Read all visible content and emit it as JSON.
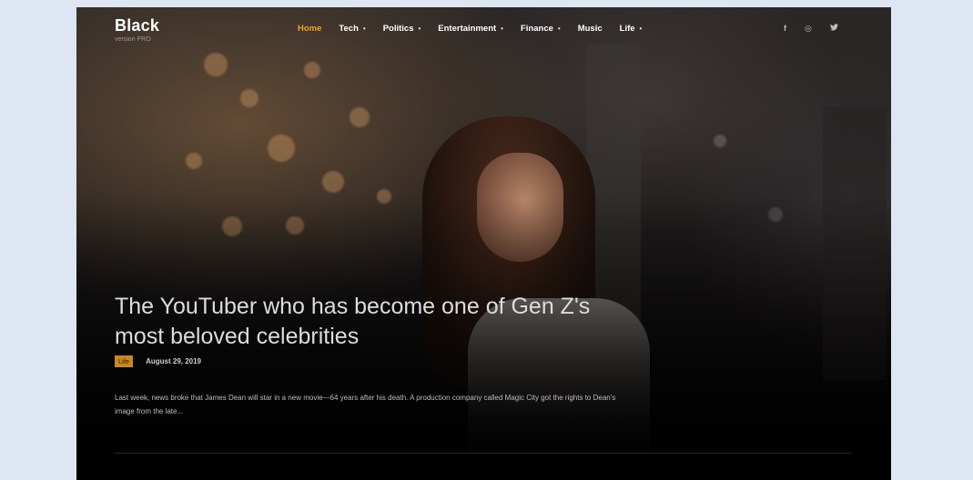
{
  "brand": {
    "name": "Black",
    "subtitle": "version PRO"
  },
  "nav": {
    "items": [
      {
        "label": "Home",
        "active": true,
        "dropdown": false
      },
      {
        "label": "Tech",
        "active": false,
        "dropdown": true
      },
      {
        "label": "Politics",
        "active": false,
        "dropdown": true
      },
      {
        "label": "Entertainment",
        "active": false,
        "dropdown": true
      },
      {
        "label": "Finance",
        "active": false,
        "dropdown": true
      },
      {
        "label": "Music",
        "active": false,
        "dropdown": false
      },
      {
        "label": "Life",
        "active": false,
        "dropdown": true
      }
    ],
    "dropdown_glyph": "•"
  },
  "social": {
    "facebook": "f",
    "instagram": "◎",
    "twitter": "🐦"
  },
  "hero": {
    "title": "The YouTuber who has become one of Gen Z's most beloved celebrities",
    "category": "Life",
    "date": "August 29, 2019",
    "excerpt": "Last week, news broke that James Dean will star in a new movie—64 years after his death. A production company called Magic City got the rights to Dean's image from the late..."
  },
  "colors": {
    "accent": "#f2a31c",
    "tag_bg": "#c8891f",
    "page_bg": "#dde6f2",
    "frame_bg": "#0b0b0d"
  }
}
